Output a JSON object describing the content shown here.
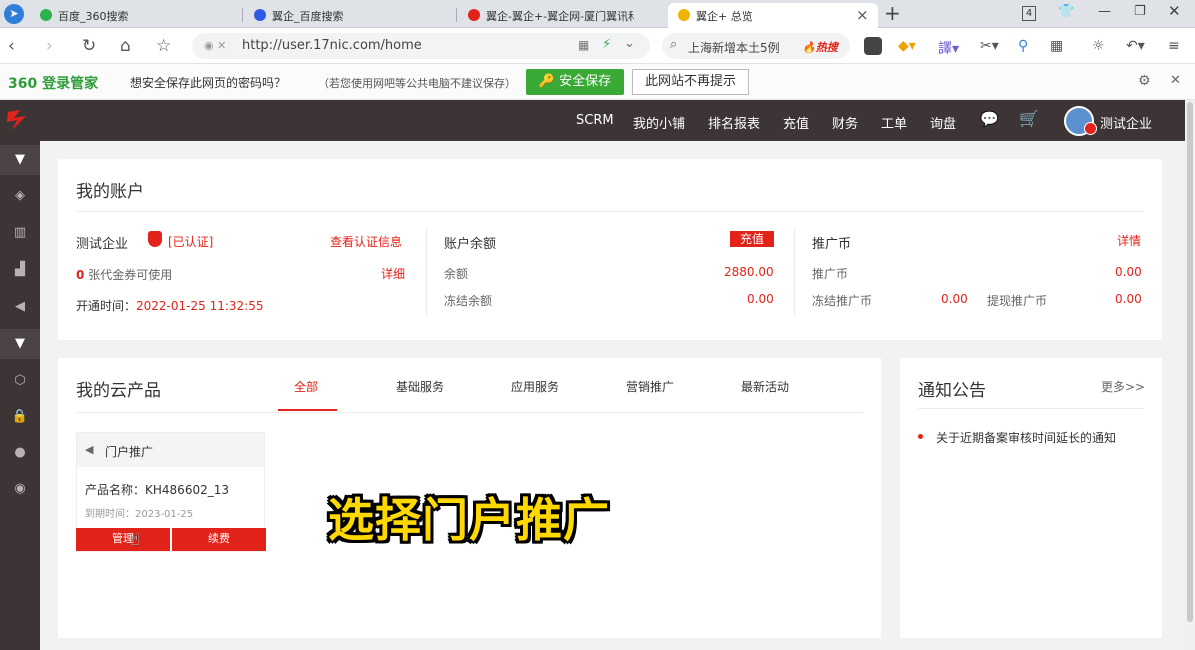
{
  "browser": {
    "tabs": [
      {
        "label": "百度_360搜索"
      },
      {
        "label": "翼企_百度搜索"
      },
      {
        "label": "翼企-翼企+-翼企网-厦门翼讯科"
      },
      {
        "label": "翼企+ 总览"
      }
    ],
    "tab_close": "×",
    "new_tab": "+",
    "tab_count": "4",
    "url": "http://user.17nic.com/home",
    "search_text": "上海新增本土5例",
    "hot_label": "热搜"
  },
  "password_bar": {
    "logo": "360 登录管家",
    "message": "想安全保存此网页的密码吗？",
    "hint": "（若您使用网吧等公共电脑不建议保存）",
    "save_button": "安全保存",
    "never_button": "此网站不再提示"
  },
  "topnav": {
    "items": [
      "SCRM",
      "我的小铺",
      "排名报表",
      "充值",
      "财务",
      "工单",
      "询盘"
    ],
    "user_name": "测试企业"
  },
  "account": {
    "title": "我的账户",
    "company": "测试企业",
    "verified": "[已认证]",
    "view_cert": "查看认证信息",
    "voucher_count": "0",
    "voucher_text": "张代金券可使用",
    "voucher_detail": "详细",
    "open_time_label": "开通时间：",
    "open_time": "2022-01-25 11:32:55",
    "balance_title": "账户余额",
    "recharge": "充值",
    "balance_label": "余额",
    "balance_value": "2880.00",
    "frozen_label": "冻结余额",
    "frozen_value": "0.00",
    "promo_title": "推广币",
    "promo_detail": "详情",
    "promo_label": "推广币",
    "promo_value": "0.00",
    "promo_frozen_label": "冻结推广币",
    "promo_frozen_value": "0.00",
    "promo_withdraw_label": "提现推广币",
    "promo_withdraw_value": "0.00"
  },
  "products": {
    "title": "我的云产品",
    "tabs": [
      "全部",
      "基础服务",
      "应用服务",
      "营销推广",
      "最新活动"
    ],
    "card": {
      "name": "门户推广",
      "product_label": "产品名称：",
      "product_value": "KH486602_13",
      "expire_label": "到期时间：",
      "expire_value": "2023-01-25",
      "manage": "管理",
      "renew": "续费"
    }
  },
  "notice": {
    "title": "通知公告",
    "more": "更多>>",
    "items": [
      "关于近期备案审核时间延长的通知"
    ]
  },
  "overlay_caption": "选择门户推广",
  "colors": {
    "brand_red": "#e2231a",
    "dark_nav": "#3d3535",
    "green": "#3aa935"
  }
}
